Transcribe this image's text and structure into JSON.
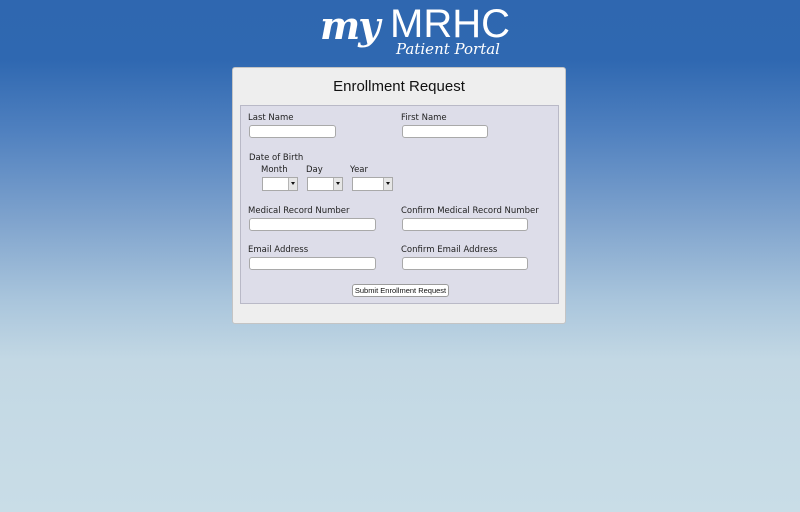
{
  "brand": {
    "logo_my": "my",
    "logo_name": "MRHC",
    "logo_subtitle": "Patient Portal",
    "logo_color": "#ffffff"
  },
  "page": {
    "title": "Enrollment Request"
  },
  "form": {
    "last_name": {
      "label": "Last Name",
      "value": ""
    },
    "first_name": {
      "label": "First Name",
      "value": ""
    },
    "dob": {
      "label": "Date of Birth",
      "month_label": "Month",
      "day_label": "Day",
      "year_label": "Year",
      "month_value": "",
      "day_value": "",
      "year_value": ""
    },
    "mrn": {
      "label": "Medical Record Number",
      "value": ""
    },
    "mrn_confirm": {
      "label": "Confirm Medical Record Number",
      "value": ""
    },
    "email": {
      "label": "Email Address",
      "value": ""
    },
    "email_confirm": {
      "label": "Confirm Email Address",
      "value": ""
    },
    "submit_label": "Submit Enrollment Request"
  },
  "colors": {
    "background_top": "#2f67b0",
    "background_bottom": "#c9dde7",
    "panel_bg": "#eeeeee",
    "form_bg": "#dddde9"
  }
}
